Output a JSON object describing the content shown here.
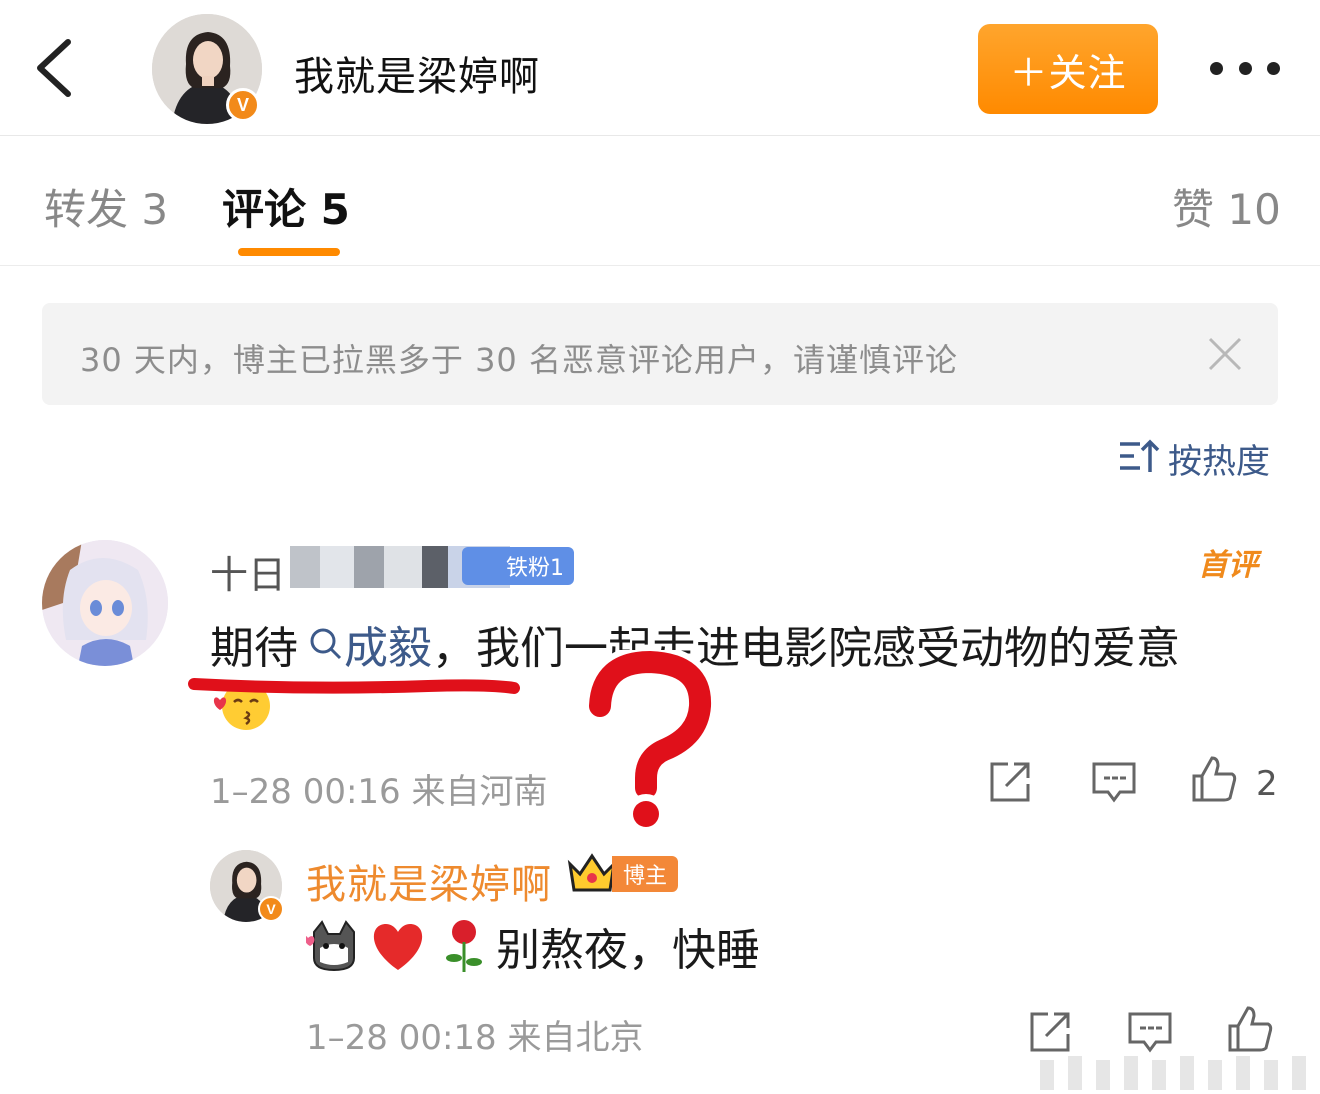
{
  "header": {
    "title": "我就是梁婷啊",
    "verified_badge": "V",
    "follow_label": "＋关注",
    "icons": [
      "back-arrow-icon",
      "more-dots-icon"
    ]
  },
  "tabs": [
    {
      "label": "转发 3"
    },
    {
      "label": "评论 5"
    },
    {
      "label": "赞 10"
    }
  ],
  "active_tab_color": "#ff8a00",
  "notice": {
    "text": "30 天内，博主已拉黑多于 30 名恶意评论用户，请谨慎评论",
    "close_icon": "close-icon"
  },
  "sort": {
    "label": "按热度",
    "icon": "sort-icon"
  },
  "comment": {
    "username_visible": "十日",
    "fan_tag": "铁粉1",
    "first_badge": "首评",
    "text_before": "期待",
    "search_link": "成毅",
    "text_after": "，我们一起走进电影院感受动物的爱意",
    "emoji": "kiss-emoji",
    "meta": "1–28 00:16 来自河南",
    "like_count": "2"
  },
  "reply": {
    "username": "我就是梁婷啊",
    "host_tag": "博主",
    "verified_badge": "V",
    "text": "别熬夜，快睡",
    "emojis": [
      "cat-emoji",
      "heart-emoji",
      "rose-emoji"
    ],
    "meta": "1–28 00:18 来自北京"
  },
  "colors": {
    "link": "#3d5a8a",
    "orange": "#ff8a00",
    "annotation_red": "#e0101a"
  }
}
